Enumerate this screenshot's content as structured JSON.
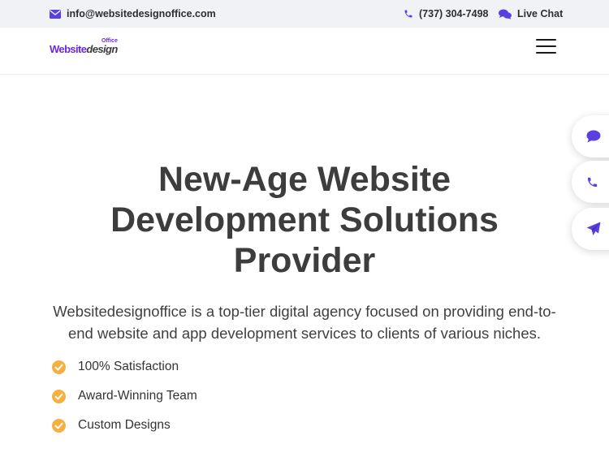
{
  "topbar": {
    "email": "info@websitedesignoffice.com",
    "phone": "(737) 304-7498",
    "chat_label": "Live Chat"
  },
  "logo": {
    "word_primary": "Website",
    "word_secondary": "design",
    "superscript": "Office"
  },
  "hero": {
    "title_line1": "New-Age Website",
    "title_line2": "Development Solutions",
    "title_line3": "Provider",
    "description": "Websitedesignoffice is a top-tier digital agency focused on providing end-to-end website and app development services to clients of various niches."
  },
  "features": [
    {
      "label": "100% Satisfaction"
    },
    {
      "label": "Award-Winning Team"
    },
    {
      "label": "Custom Designs"
    }
  ],
  "colors": {
    "accent": "#6d28d9",
    "icon_purple": "#5b3fe0",
    "check_orange": "#f5b041",
    "topbar_bg": "#f1f2f6",
    "text_dark": "#3d3d3d"
  },
  "icons": {
    "email": "envelope-icon",
    "phone": "phone-icon",
    "chat": "chat-bubbles-icon",
    "menu": "hamburger-menu-icon",
    "feature": "check-circle-icon",
    "float_chat": "chat-icon",
    "float_phone": "phone-icon",
    "float_send": "paper-plane-icon"
  }
}
